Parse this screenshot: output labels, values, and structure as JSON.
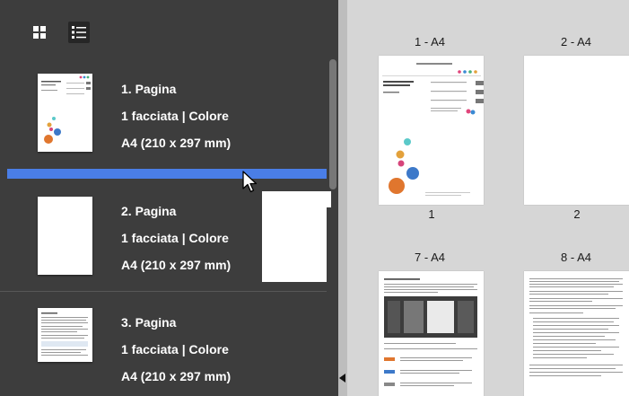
{
  "toolbar": {
    "grid_view_icon": "grid-view-icon",
    "list_view_icon": "list-view-icon"
  },
  "page_list": [
    {
      "title": "1. Pagina",
      "sides": "1 facciata | Colore",
      "size": "A4 (210 x 297 mm)"
    },
    {
      "title": "2. Pagina",
      "sides": "1 facciata | Colore",
      "size": "A4 (210 x 297 mm)"
    },
    {
      "title": "3. Pagina",
      "sides": "1 facciata | Colore",
      "size": "A4 (210 x 297 mm)"
    }
  ],
  "page_grid": [
    {
      "label": "1 - A4",
      "number": "1"
    },
    {
      "label": "2 - A4",
      "number": "2"
    },
    {
      "label": "7 - A4"
    },
    {
      "label": "8 - A4"
    }
  ],
  "colors": {
    "panel": "#3d3d3d",
    "drop_indicator": "#4a7ee6",
    "workspace": "#d6d6d6"
  }
}
